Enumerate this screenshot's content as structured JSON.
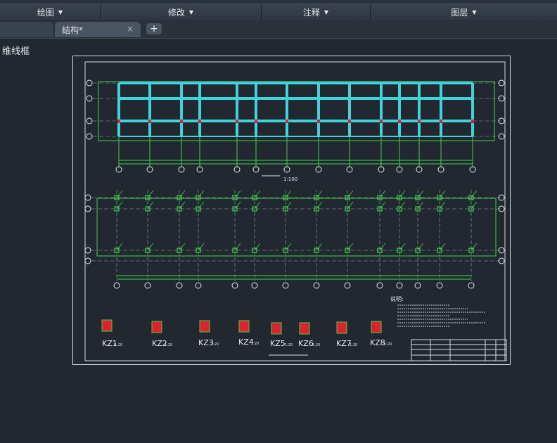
{
  "ribbon": {
    "panels": [
      {
        "label": "绘图"
      },
      {
        "label": "修改"
      },
      {
        "label": "注释"
      },
      {
        "label": "图层"
      }
    ]
  },
  "tabs": [
    {
      "label": ""
    },
    {
      "label": "结构*"
    }
  ],
  "new_tab_symbol": "+",
  "close_symbol": "×",
  "viewport": {
    "label": "维线框"
  },
  "drawing": {
    "plan_scale": "1:100",
    "column_details": [
      {
        "label": "KZ1",
        "scale": "1:20"
      },
      {
        "label": "KZ2",
        "scale": "1:20"
      },
      {
        "label": "KZ3",
        "scale": "1:20"
      },
      {
        "label": "KZ4",
        "scale": "1:20"
      },
      {
        "label": "KZ5",
        "scale": "1:20"
      },
      {
        "label": "KZ6",
        "scale": "1:20"
      },
      {
        "label": "KZ7",
        "scale": "1:20"
      },
      {
        "label": "KZ8",
        "scale": "1:20"
      }
    ],
    "notes_title": "说明:"
  },
  "colors": {
    "background": "#212830",
    "beam": "#3fd4dc",
    "grid": "#3fd44a",
    "column": "#e0202a",
    "paper": "#d8dde3"
  }
}
